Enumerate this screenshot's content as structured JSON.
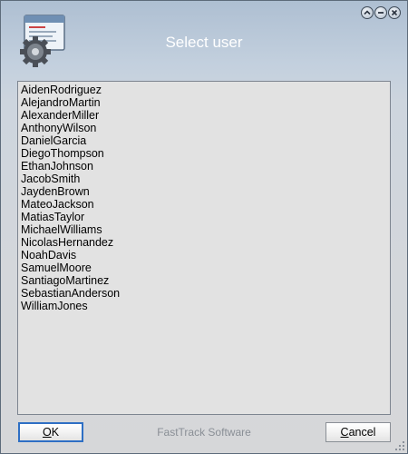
{
  "window": {
    "title": "Select user",
    "controls": [
      {
        "name": "collapse-icon",
        "glyph": "up-circle"
      },
      {
        "name": "minimize-icon",
        "glyph": "minus-circle"
      },
      {
        "name": "close-icon",
        "glyph": "x-circle"
      }
    ],
    "app_icon": "window-gear-icon"
  },
  "users": [
    "AidenRodriguez",
    "AlejandroMartin",
    "AlexanderMiller",
    "AnthonyWilson",
    "DanielGarcia",
    "DiegoThompson",
    "EthanJohnson",
    "JacobSmith",
    "JaydenBrown",
    "MateoJackson",
    "MatiasTaylor",
    "MichaelWilliams",
    "NicolasHernandez",
    "NoahDavis",
    "SamuelMoore",
    "SantiagoMartinez",
    "SebastianAnderson",
    "WilliamJones"
  ],
  "footer": {
    "ok_label": "OK",
    "cancel_label": "Cancel",
    "brand": "FastTrack Software"
  },
  "colors": {
    "focus_border": "#2e6fc4",
    "title_text": "#ffffff",
    "list_background": "#e2e2e2"
  }
}
